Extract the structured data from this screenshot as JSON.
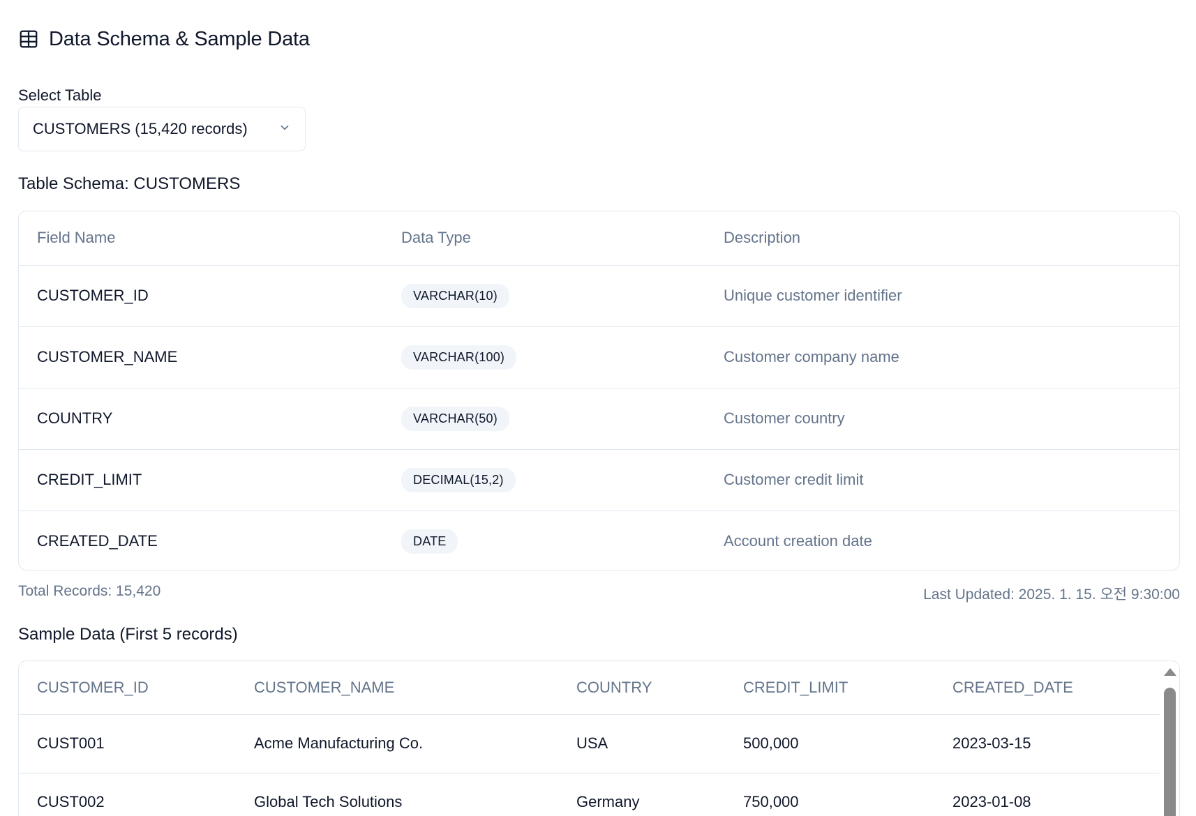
{
  "header": {
    "title": "Data Schema & Sample Data",
    "icon": "table-icon"
  },
  "table_select": {
    "label": "Select Table",
    "selected": "CUSTOMERS (15,420 records)"
  },
  "schema": {
    "title": "Table Schema: CUSTOMERS",
    "columns": [
      "Field Name",
      "Data Type",
      "Description"
    ],
    "rows": [
      {
        "field": "CUSTOMER_ID",
        "type": "VARCHAR(10)",
        "description": "Unique customer identifier"
      },
      {
        "field": "CUSTOMER_NAME",
        "type": "VARCHAR(100)",
        "description": "Customer company name"
      },
      {
        "field": "COUNTRY",
        "type": "VARCHAR(50)",
        "description": "Customer country"
      },
      {
        "field": "CREDIT_LIMIT",
        "type": "DECIMAL(15,2)",
        "description": "Customer credit limit"
      },
      {
        "field": "CREATED_DATE",
        "type": "DATE",
        "description": "Account creation date"
      }
    ]
  },
  "footer": {
    "total_records": "Total Records: 15,420",
    "last_updated": "Last Updated: 2025. 1. 15. 오전 9:30:00"
  },
  "sample": {
    "title": "Sample Data (First 5 records)",
    "columns": [
      "CUSTOMER_ID",
      "CUSTOMER_NAME",
      "COUNTRY",
      "CREDIT_LIMIT",
      "CREATED_DATE"
    ],
    "rows": [
      [
        "CUST001",
        "Acme Manufacturing Co.",
        "USA",
        "500,000",
        "2023-03-15"
      ],
      [
        "CUST002",
        "Global Tech Solutions",
        "Germany",
        "750,000",
        "2023-01-08"
      ]
    ]
  },
  "colors": {
    "text_primary": "#0f172a",
    "text_muted": "#64748b",
    "border": "#e2e8f0",
    "badge_bg": "#f1f5f9"
  }
}
